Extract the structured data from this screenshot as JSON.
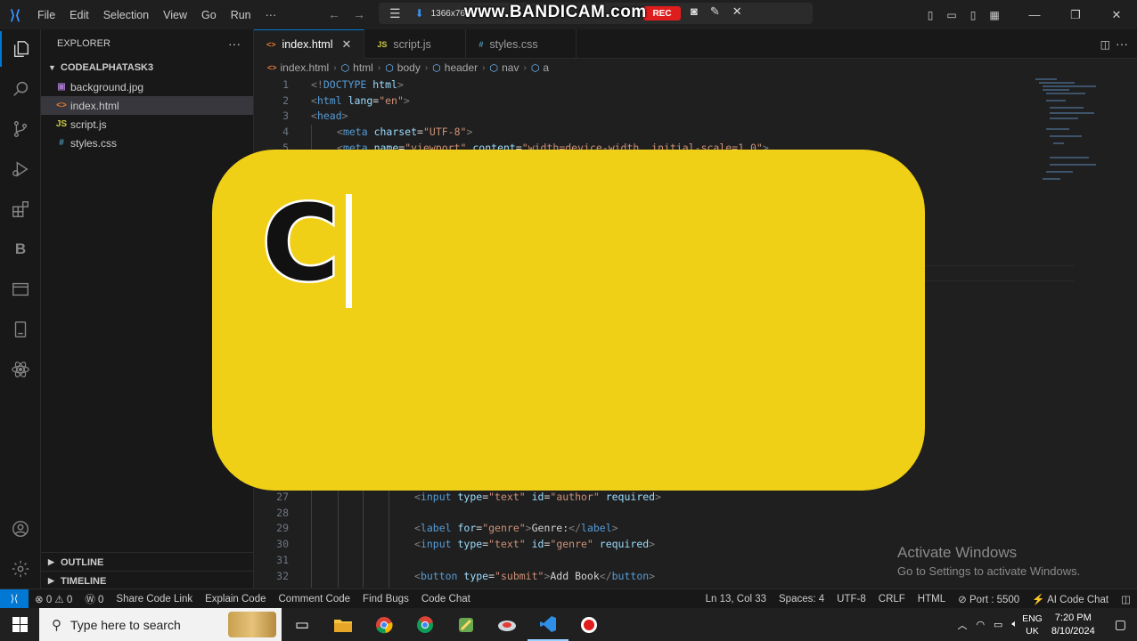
{
  "menu": [
    "File",
    "Edit",
    "Selection",
    "View",
    "Go",
    "Run",
    "···"
  ],
  "bandicam": {
    "resolution": "1366x768",
    "rec_label": "REC",
    "watermark": "www.BANDICAM.com"
  },
  "explorer": {
    "title": "EXPLORER",
    "more": "···",
    "folder": "CODEALPHATASK3",
    "files": [
      {
        "name": "background.jpg",
        "icon": "image-file-icon",
        "glyph": "▣",
        "color": "#a074c4"
      },
      {
        "name": "index.html",
        "icon": "html-file-icon",
        "glyph": "<>",
        "color": "#e37933",
        "selected": true
      },
      {
        "name": "script.js",
        "icon": "js-file-icon",
        "glyph": "JS",
        "color": "#cbcb41"
      },
      {
        "name": "styles.css",
        "icon": "css-file-icon",
        "glyph": "#",
        "color": "#519aba"
      }
    ],
    "outline": "OUTLINE",
    "timeline": "TIMELINE"
  },
  "tabs": [
    {
      "label": "index.html",
      "glyph": "<>",
      "color": "#e37933",
      "active": true,
      "close": "✕"
    },
    {
      "label": "script.js",
      "glyph": "JS",
      "color": "#cbcb41",
      "active": false
    },
    {
      "label": "styles.css",
      "glyph": "#",
      "color": "#519aba",
      "active": false
    }
  ],
  "breadcrumb": [
    "index.html",
    "html",
    "body",
    "header",
    "nav",
    "a"
  ],
  "code_top": [
    {
      "n": "1",
      "indent": 0,
      "parts": [
        [
          "tg",
          "<!"
        ],
        [
          "tn",
          "DOCTYPE"
        ],
        [
          "at",
          " html"
        ],
        [
          "tg",
          ">"
        ]
      ]
    },
    {
      "n": "2",
      "indent": 0,
      "parts": [
        [
          "tg",
          "<"
        ],
        [
          "tn",
          "html"
        ],
        [
          "at",
          " lang"
        ],
        [
          "tx",
          "="
        ],
        [
          "sv",
          "\"en\""
        ],
        [
          "tg",
          ">"
        ]
      ]
    },
    {
      "n": "3",
      "indent": 0,
      "parts": [
        [
          "tg",
          "<"
        ],
        [
          "tn",
          "head"
        ],
        [
          "tg",
          ">"
        ]
      ]
    },
    {
      "n": "4",
      "indent": 1,
      "parts": [
        [
          "tg",
          "<"
        ],
        [
          "tn",
          "meta"
        ],
        [
          "at",
          " charset"
        ],
        [
          "tx",
          "="
        ],
        [
          "sv",
          "\"UTF-8\""
        ],
        [
          "tg",
          ">"
        ]
      ]
    },
    {
      "n": "5",
      "indent": 1,
      "parts": [
        [
          "tg",
          "<"
        ],
        [
          "tn",
          "meta"
        ],
        [
          "at",
          " name"
        ],
        [
          "tx",
          "="
        ],
        [
          "sv",
          "\"viewport\""
        ],
        [
          "at",
          " content"
        ],
        [
          "tx",
          "="
        ],
        [
          "sv",
          "\"width=device-width, initial-scale=1.0\""
        ],
        [
          "tg",
          ">"
        ]
      ]
    }
  ],
  "code_bottom": [
    {
      "n": "27",
      "indent": 4,
      "parts": [
        [
          "tg",
          "<"
        ],
        [
          "tn",
          "input"
        ],
        [
          "at",
          " type"
        ],
        [
          "tx",
          "="
        ],
        [
          "sv",
          "\"text\""
        ],
        [
          "at",
          " id"
        ],
        [
          "tx",
          "="
        ],
        [
          "sv",
          "\"author\""
        ],
        [
          "at",
          " required"
        ],
        [
          "tg",
          ">"
        ]
      ]
    },
    {
      "n": "28",
      "indent": 4,
      "parts": []
    },
    {
      "n": "29",
      "indent": 4,
      "parts": [
        [
          "tg",
          "<"
        ],
        [
          "tn",
          "label"
        ],
        [
          "at",
          " for"
        ],
        [
          "tx",
          "="
        ],
        [
          "sv",
          "\"genre\""
        ],
        [
          "tg",
          ">"
        ],
        [
          "tx",
          "Genre:"
        ],
        [
          "tg",
          "</"
        ],
        [
          "tn",
          "label"
        ],
        [
          "tg",
          ">"
        ]
      ]
    },
    {
      "n": "30",
      "indent": 4,
      "parts": [
        [
          "tg",
          "<"
        ],
        [
          "tn",
          "input"
        ],
        [
          "at",
          " type"
        ],
        [
          "tx",
          "="
        ],
        [
          "sv",
          "\"text\""
        ],
        [
          "at",
          " id"
        ],
        [
          "tx",
          "="
        ],
        [
          "sv",
          "\"genre\""
        ],
        [
          "at",
          " required"
        ],
        [
          "tg",
          ">"
        ]
      ]
    },
    {
      "n": "31",
      "indent": 4,
      "parts": []
    },
    {
      "n": "32",
      "indent": 4,
      "parts": [
        [
          "tg",
          "<"
        ],
        [
          "tn",
          "button"
        ],
        [
          "at",
          " type"
        ],
        [
          "tx",
          "="
        ],
        [
          "sv",
          "\"submit\""
        ],
        [
          "tg",
          ">"
        ],
        [
          "tx",
          "Add Book"
        ],
        [
          "tg",
          "</"
        ],
        [
          "tn",
          "button"
        ],
        [
          "tg",
          ">"
        ]
      ]
    }
  ],
  "overlay": {
    "letter": "C",
    "color": "#f0cf17"
  },
  "activate": {
    "title": "Activate Windows",
    "subtitle": "Go to Settings to activate Windows."
  },
  "status": {
    "remote": "⟩⟨",
    "problems": "⊗ 0 ⚠ 0",
    "ports_count": "Ⓦ 0",
    "left_items": [
      "Share Code Link",
      "Explain Code",
      "Comment Code",
      "Find Bugs",
      "Code Chat"
    ],
    "position": "Ln 13, Col 33",
    "spaces": "Spaces: 4",
    "encoding": "UTF-8",
    "eol": "CRLF",
    "language": "HTML",
    "port": "⊘ Port : 5500",
    "ai": "⚡ AI Code Chat",
    "bell": "🔔"
  },
  "taskbar": {
    "search_placeholder": "Type here to search",
    "lang_top": "ENG",
    "lang_bottom": "UK",
    "time": "7:20 PM",
    "date": "8/10/2024"
  }
}
